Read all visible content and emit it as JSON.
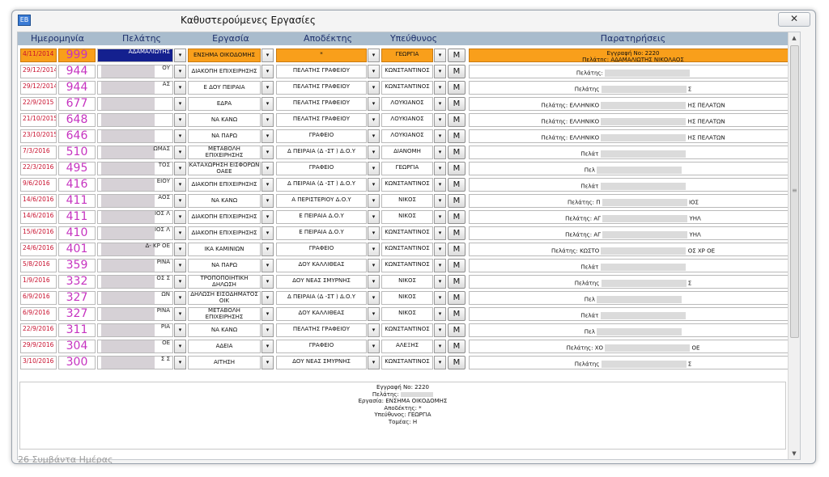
{
  "window": {
    "title": "Καθυστερούμενες Εργασίες",
    "close_label": "✕",
    "icon_label": "EB"
  },
  "headers": {
    "date": "Ημερομηνία",
    "client": "Πελάτης",
    "task": "Εργασία",
    "recipient": "Αποδέκτης",
    "responsible": "Υπεύθυνος",
    "notes": "Παρατηρήσεις"
  },
  "dropdown_glyph": "▾",
  "m_label": "M",
  "rows": [
    {
      "date": "4/11/2014",
      "num": "999",
      "client": "ΑΔΑΜΑΛΙΩΤΗΣ",
      "task": "ΕΝΣΗΜΑ ΟΙΚΟΔΟΜΗΣ",
      "recipient": "*",
      "responsible": "ΓΕΩΡΓΙΑ",
      "notes": "Εγγραφή Νο: 2220",
      "notes2": "Πελάτης: ΑΔΑΜΑΛΙΩΤΗΣ ΝΙΚΟΛΑΟΣ"
    },
    {
      "date": "29/12/2014",
      "num": "944",
      "client": "ΟΥ",
      "task": "ΔΙΑΚΟΠΗ ΕΠΙΧΕΙΡΗΣΗΣ",
      "recipient": "ΠΕΛΑΤΗΣ ΓΡΑΦΕΙΟΥ",
      "responsible": "ΚΩΝΣΤΑΝΤΙΝΟΣ",
      "notes": "Πελάτης:",
      "notes2": ""
    },
    {
      "date": "29/12/2014",
      "num": "944",
      "client": "ΑΣ",
      "task": "Ε ΔΟΥ ΠΕΙΡΑΙΑ",
      "recipient": "ΠΕΛΑΤΗΣ ΓΡΑΦΕΙΟΥ",
      "responsible": "ΚΩΝΣΤΑΝΤΙΝΟΣ",
      "notes": "Πελάτης",
      "notes2": "Σ"
    },
    {
      "date": "22/9/2015",
      "num": "677",
      "client": "",
      "task": "ΕΔΡΑ",
      "recipient": "ΠΕΛΑΤΗΣ ΓΡΑΦΕΙΟΥ",
      "responsible": "ΛΟΥΚΙΑΝΟΣ",
      "notes": "Πελάτης: ΕΛΛΗΝΙΚΟ",
      "notes2": "ΗΣ ΠΕΛΑΤΩΝ"
    },
    {
      "date": "21/10/2015",
      "num": "648",
      "client": "",
      "task": "ΝΑ ΚΑΝΩ",
      "recipient": "ΠΕΛΑΤΗΣ ΓΡΑΦΕΙΟΥ",
      "responsible": "ΛΟΥΚΙΑΝΟΣ",
      "notes": "Πελάτης: ΕΛΛΗΝΙΚΟ",
      "notes2": "ΗΣ ΠΕΛΑΤΩΝ"
    },
    {
      "date": "23/10/2015",
      "num": "646",
      "client": "",
      "task": "ΝΑ ΠΑΡΩ",
      "recipient": "ΓΡΑΦΕΙΟ",
      "responsible": "ΛΟΥΚΙΑΝΟΣ",
      "notes": "Πελάτης: ΕΛΛΗΝΙΚΟ",
      "notes2": "ΗΣ ΠΕΛΑΤΩΝ"
    },
    {
      "date": "7/3/2016",
      "num": "510",
      "client": "ΩΜΑΣ",
      "task": "ΜΕΤΑΒΟΛΗ ΕΠΙΧΕΙΡΗΣΗΣ",
      "recipient": "Δ ΠΕΙΡΑΙΑ (Δ -ΣΤ ) Δ.Ο.Υ",
      "responsible": "ΔΙΑΝΟΜΗ",
      "notes": "Πελάτ",
      "notes2": ""
    },
    {
      "date": "22/3/2016",
      "num": "495",
      "client": "ΤΟΣ",
      "task": "ΚΑΤΑΧΩΡΗΣΗ ΕΙΣΦΟΡΩΝ ΟΑΕΕ",
      "recipient": "ΓΡΑΦΕΙΟ",
      "responsible": "ΓΕΩΡΓΙΑ",
      "notes": "Πελ",
      "notes2": ""
    },
    {
      "date": "9/6/2016",
      "num": "416",
      "client": "ΕΙΟΥ",
      "task": "ΔΙΑΚΟΠΗ ΕΠΙΧΕΙΡΗΣΗΣ",
      "recipient": "Δ ΠΕΙΡΑΙΑ (Δ -ΣΤ ) Δ.Ο.Υ",
      "responsible": "ΚΩΝΣΤΑΝΤΙΝΟΣ",
      "notes": "Πελάτ",
      "notes2": ""
    },
    {
      "date": "14/6/2016",
      "num": "411",
      "client": "ΑΟΣ",
      "task": "ΝΑ ΚΑΝΩ",
      "recipient": "Α ΠΕΡΙΣΤΕΡΙΟΥ Δ.Ο.Υ",
      "responsible": "ΝΙΚΟΣ",
      "notes": "Πελάτης: Π",
      "notes2": "ΙΟΣ"
    },
    {
      "date": "14/6/2016",
      "num": "411",
      "client": "ΙΟΣ Λ",
      "task": "ΔΙΑΚΟΠΗ ΕΠΙΧΕΙΡΗΣΗΣ",
      "recipient": "Ε ΠΕΙΡΑΙΑ Δ.Ο.Υ",
      "responsible": "ΝΙΚΟΣ",
      "notes": "Πελάτης: ΑΓ",
      "notes2": "ΥΗΛ"
    },
    {
      "date": "15/6/2016",
      "num": "410",
      "client": "ΙΟΣ Λ",
      "task": "ΔΙΑΚΟΠΗ ΕΠΙΧΕΙΡΗΣΗΣ",
      "recipient": "Ε ΠΕΙΡΑΙΑ Δ.Ο.Υ",
      "responsible": "ΚΩΝΣΤΑΝΤΙΝΟΣ",
      "notes": "Πελάτης: ΑΓ",
      "notes2": "ΥΗΛ"
    },
    {
      "date": "24/6/2016",
      "num": "401",
      "client": "Δ- ΚΡ ΟΕ",
      "task": "ΙΚΑ ΚΑΜΙΝΙΩΝ",
      "recipient": "ΓΡΑΦΕΙΟ",
      "responsible": "ΚΩΝΣΤΑΝΤΙΝΟΣ",
      "notes": "Πελάτης: ΚΩΣΤΟ",
      "notes2": "ΟΣ ΧΡ ΟΕ"
    },
    {
      "date": "5/8/2016",
      "num": "359",
      "client": "ΡΙΝΑ",
      "task": "ΝΑ ΠΑΡΩ",
      "recipient": "ΔΟΥ ΚΑΛΛΙΘΕΑΣ",
      "responsible": "ΚΩΝΣΤΑΝΤΙΝΟΣ",
      "notes": "Πελάτ",
      "notes2": ""
    },
    {
      "date": "1/9/2016",
      "num": "332",
      "client": "ΟΣ Σ",
      "task": "ΤΡΟΠΟΠΟΙΗΤΙΚΗ ΔΗΛΩΣΗ",
      "recipient": "ΔΟΥ ΝΕΑΣ ΣΜΥΡΝΗΣ",
      "responsible": "ΝΙΚΟΣ",
      "notes": "Πελάτης",
      "notes2": "Σ"
    },
    {
      "date": "6/9/2016",
      "num": "327",
      "client": "ΩΝ",
      "task": "ΔΗΛΩΣΗ ΕΙΣΟΔΗΜΑΤΟΣ ΟΙΚ",
      "recipient": "Δ ΠΕΙΡΑΙΑ (Δ -ΣΤ ) Δ.Ο.Υ",
      "responsible": "ΝΙΚΟΣ",
      "notes": "Πελ",
      "notes2": ""
    },
    {
      "date": "6/9/2016",
      "num": "327",
      "client": "ΡΙΝΑ",
      "task": "ΜΕΤΑΒΟΛΗ ΕΠΙΧΕΙΡΗΣΗΣ",
      "recipient": "ΔΟΥ ΚΑΛΛΙΘΕΑΣ",
      "responsible": "ΝΙΚΟΣ",
      "notes": "Πελάτ",
      "notes2": ""
    },
    {
      "date": "22/9/2016",
      "num": "311",
      "client": "ΡΙΑ",
      "task": "ΝΑ ΚΑΝΩ",
      "recipient": "ΠΕΛΑΤΗΣ ΓΡΑΦΕΙΟΥ",
      "responsible": "ΚΩΝΣΤΑΝΤΙΝΟΣ",
      "notes": "Πελ",
      "notes2": ""
    },
    {
      "date": "29/9/2016",
      "num": "304",
      "client": "ΟΕ",
      "task": "ΑΔΕΙΑ",
      "recipient": "ΓΡΑΦΕΙΟ",
      "responsible": "ΑΛΕΞΗΣ",
      "notes": "Πελάτης: ΧΟ",
      "notes2": "ΟΕ"
    },
    {
      "date": "3/10/2016",
      "num": "300",
      "client": "Σ Σ",
      "task": "ΑΙΤΗΣΗ",
      "recipient": "ΔΟΥ ΝΕΑΣ ΣΜΥΡΝΗΣ",
      "responsible": "ΚΩΝΣΤΑΝΤΙΝΟΣ",
      "notes": "Πελάτης",
      "notes2": "Σ"
    }
  ],
  "detail": {
    "record": "Εγγραφή Νο: 2220",
    "client": "Πελάτης:",
    "task": "Εργασία: ΕΝΣΗΜΑ ΟΙΚΟΔΟΜΗΣ",
    "recipient": "Αποδέκτης: *",
    "responsible": "Υπεύθυνος: ΓΕΩΡΓΙΑ",
    "sector": "Τομέας: Η"
  },
  "footer": "26 Συμβάντα Ημέρας",
  "scroll": {
    "up": "▲",
    "down": "▼",
    "grip": "≡"
  }
}
